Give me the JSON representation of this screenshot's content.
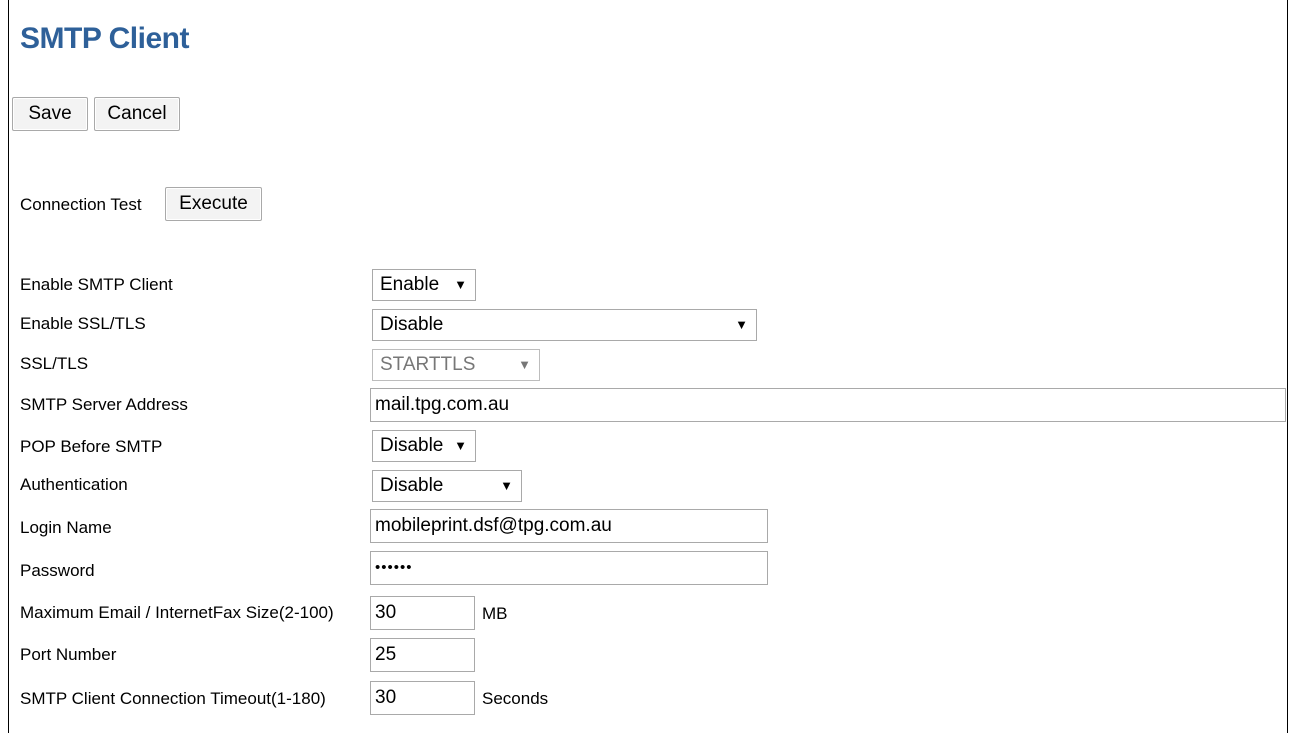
{
  "page": {
    "title": "SMTP Client"
  },
  "toolbar": {
    "save_label": "Save",
    "cancel_label": "Cancel"
  },
  "connection_test": {
    "label": "Connection Test",
    "execute_label": "Execute"
  },
  "fields": {
    "enable_smtp_client": {
      "label": "Enable SMTP Client",
      "value": "Enable"
    },
    "enable_ssl_tls": {
      "label": "Enable SSL/TLS",
      "value": "Disable"
    },
    "ssl_tls": {
      "label": "SSL/TLS",
      "value": "STARTTLS",
      "disabled": true
    },
    "smtp_server_address": {
      "label": "SMTP Server Address",
      "value": "mail.tpg.com.au"
    },
    "pop_before_smtp": {
      "label": "POP Before SMTP",
      "value": "Disable"
    },
    "authentication": {
      "label": "Authentication",
      "value": "Disable"
    },
    "login_name": {
      "label": "Login Name",
      "value": "mobileprint.dsf@tpg.com.au"
    },
    "password": {
      "label": "Password",
      "value": "••••••"
    },
    "max_email_size": {
      "label": "Maximum Email / InternetFax Size(2-100)",
      "value": "30",
      "unit": "MB"
    },
    "port_number": {
      "label": "Port Number",
      "value": "25"
    },
    "connection_timeout": {
      "label": "SMTP Client Connection Timeout(1-180)",
      "value": "30",
      "unit": "Seconds"
    }
  },
  "icons": {
    "dropdown_arrow": "▼"
  }
}
